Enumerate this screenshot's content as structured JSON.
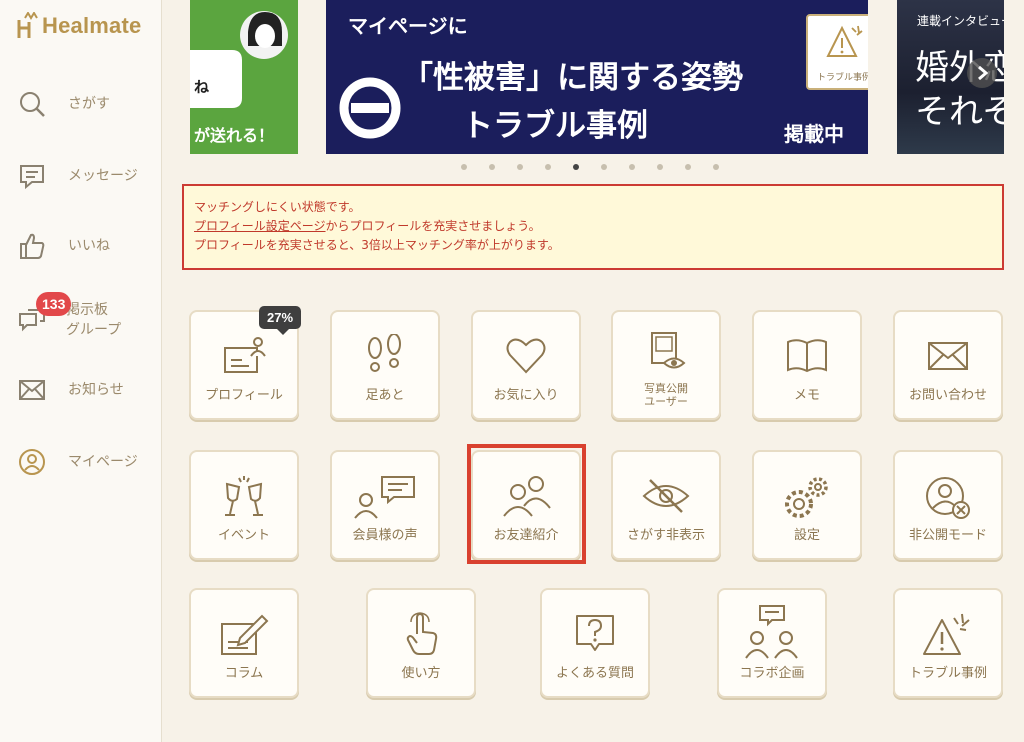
{
  "app": {
    "logo_text": "Healmate"
  },
  "sidebar": {
    "items": [
      {
        "label": "さがす",
        "icon": "search-icon"
      },
      {
        "label": "メッセージ",
        "icon": "message-icon"
      },
      {
        "label": "いいね",
        "icon": "thumbs-up-icon"
      },
      {
        "label": "掲示板",
        "label2": "グループ",
        "badge": "133",
        "icon": "board-icon"
      },
      {
        "label": "お知らせ",
        "icon": "envelope-icon"
      },
      {
        "label": "マイページ",
        "icon": "user-circle-icon"
      }
    ]
  },
  "banners": {
    "left": {
      "bubble": "ね",
      "text": "が送れる！"
    },
    "center": {
      "top": "マイページに",
      "main": "「性被害」に関する姿勢",
      "sub": "トラブル事例",
      "badge": "掲載中",
      "tag": "トラブル事例"
    },
    "right": {
      "top": "連載インタビュー",
      "line1": "婚外恋",
      "line2": "それぞ"
    },
    "page_count": 10,
    "active_index": 4
  },
  "warning": {
    "line1": "マッチングしにくい状態です。",
    "line2_link": "プロフィール設定ページ",
    "line2_rest": "からプロフィールを充実させましょう。",
    "line3": "プロフィールを充実させると、3倍以上マッチング率が上がります。"
  },
  "profile_percent": "27%",
  "tiles": {
    "profile": "プロフィール",
    "footprints": "足あと",
    "favorites": "お気に入り",
    "photo_public_line1": "写真公開",
    "photo_public_line2": "ユーザー",
    "memo": "メモ",
    "contact": "お問い合わせ",
    "event": "イベント",
    "voices": "会員様の声",
    "refer": "お友達紹介",
    "hide": "さがす非表示",
    "settings": "設定",
    "private_mode": "非公開モード",
    "column": "コラム",
    "howto": "使い方",
    "faq": "よくある質問",
    "collab": "コラボ企画",
    "trouble": "トラブル事例"
  },
  "colors": {
    "accent": "#b8954f",
    "warning": "#cc3b33",
    "banner_navy": "#1b1e5c",
    "banner_green": "#5ba53f"
  }
}
